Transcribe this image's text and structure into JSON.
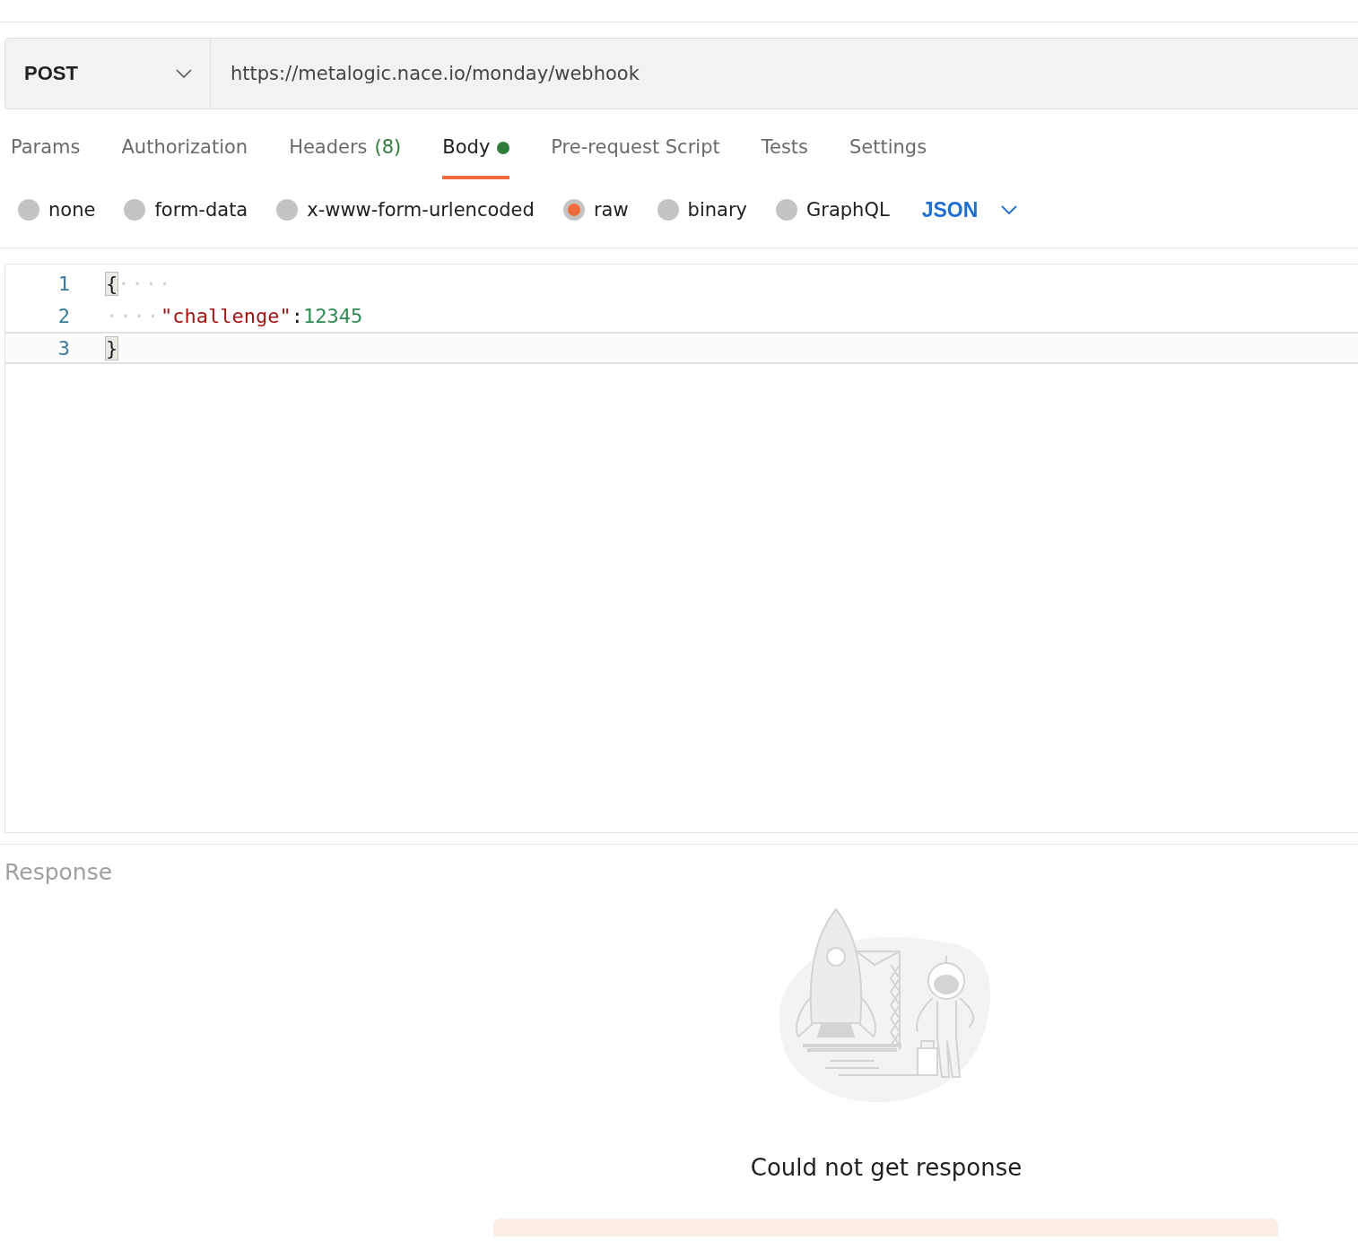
{
  "request": {
    "method": "POST",
    "url": "https://metalogic.nace.io/monday/webhook"
  },
  "tabs": [
    {
      "label": "Params",
      "selected": false
    },
    {
      "label": "Authorization",
      "selected": false
    },
    {
      "label": "Headers",
      "count": "(8)",
      "selected": false
    },
    {
      "label": "Body",
      "has_content": true,
      "selected": true
    },
    {
      "label": "Pre-request Script",
      "selected": false
    },
    {
      "label": "Tests",
      "selected": false
    },
    {
      "label": "Settings",
      "selected": false
    }
  ],
  "body_types": [
    {
      "label": "none",
      "selected": false
    },
    {
      "label": "form-data",
      "selected": false
    },
    {
      "label": "x-www-form-urlencoded",
      "selected": false
    },
    {
      "label": "raw",
      "selected": true
    },
    {
      "label": "binary",
      "selected": false
    },
    {
      "label": "GraphQL",
      "selected": false
    }
  ],
  "language": "JSON",
  "editor": {
    "lines": [
      {
        "number": "1",
        "active": false,
        "tokens": [
          {
            "kind": "bracket",
            "text": "{"
          },
          {
            "kind": "space",
            "text": "····"
          }
        ]
      },
      {
        "number": "2",
        "active": false,
        "tokens": [
          {
            "kind": "space",
            "text": "····"
          },
          {
            "kind": "key",
            "text": "\"challenge\""
          },
          {
            "kind": "punct",
            "text": ":"
          },
          {
            "kind": "number",
            "text": "12345"
          }
        ]
      },
      {
        "number": "3",
        "active": true,
        "tokens": [
          {
            "kind": "bracket",
            "text": "}"
          }
        ]
      }
    ]
  },
  "response": {
    "title": "Response",
    "message": "Could not get response"
  }
}
